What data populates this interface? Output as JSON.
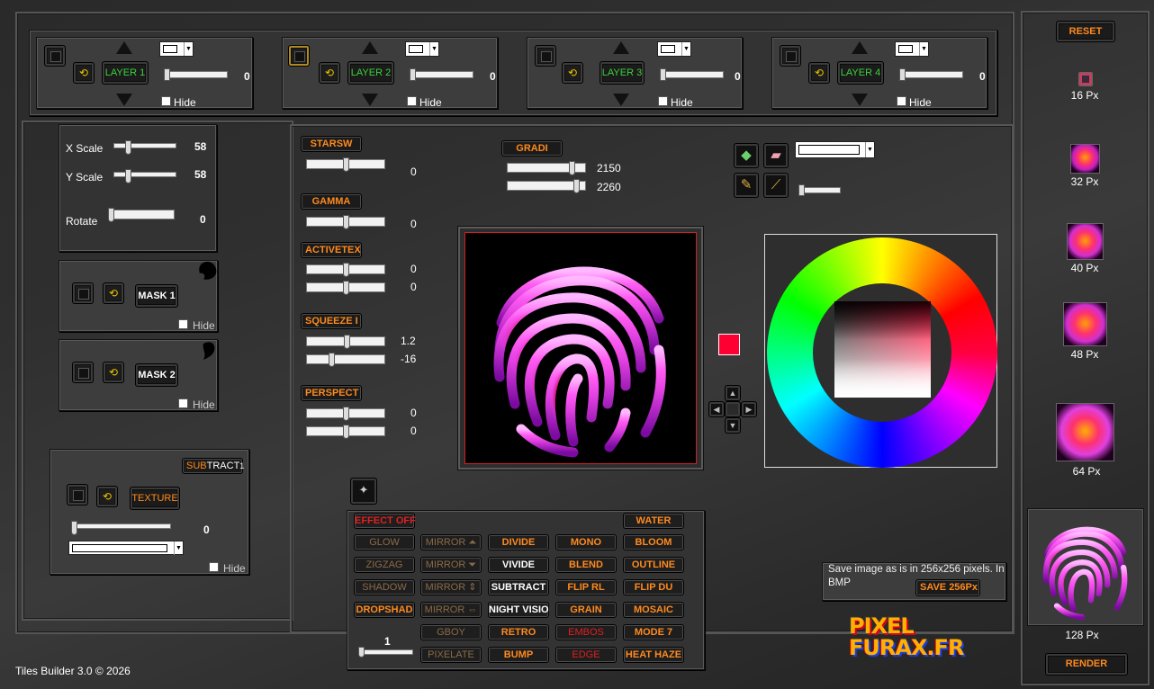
{
  "layers": [
    {
      "label": "LAYER 1",
      "opacity": "0",
      "hide": "Hide"
    },
    {
      "label": "LAYER 2",
      "opacity": "0",
      "hide": "Hide"
    },
    {
      "label": "LAYER 3",
      "opacity": "0",
      "hide": "Hide"
    },
    {
      "label": "LAYER 4",
      "opacity": "0",
      "hide": "Hide"
    }
  ],
  "transform": {
    "xscale_label": "X Scale",
    "xscale_value": "58",
    "yscale_label": "Y Scale",
    "yscale_value": "58",
    "rotate_label": "Rotate",
    "rotate_value": "0"
  },
  "masks": [
    {
      "label": "MASK 1",
      "hide": "Hide"
    },
    {
      "label": "MASK 2",
      "hide": "Hide"
    }
  ],
  "texture": {
    "blend_prefix": "SUB",
    "blend_suffix": "TRACT",
    "blend_number": "1",
    "label": "TEXTURE",
    "value": "0",
    "hide": "Hide"
  },
  "filters": [
    {
      "label": "STARSW",
      "values": [
        "0"
      ]
    },
    {
      "label": "GAMMA",
      "values": [
        "0"
      ]
    },
    {
      "label": "ACTIVETEX",
      "values": [
        "0",
        "0"
      ]
    },
    {
      "label": "SQUEEZE I",
      "values": [
        "1.2",
        "-16"
      ]
    },
    {
      "label": "PERSPECT",
      "values": [
        "0",
        "0"
      ]
    }
  ],
  "gradient": {
    "label": "GRADI",
    "values": [
      "2150",
      "2260"
    ]
  },
  "effects": {
    "off_label": "EFFECT OFF",
    "water_label": "WATER",
    "level": "1",
    "grid": [
      [
        "GLOW",
        "MIRROR ⏶",
        "DIVIDE",
        "MONO",
        "BLOOM"
      ],
      [
        "ZIGZAG",
        "MIRROR ⏷",
        "VIVIDE",
        "BLEND",
        "OUTLINE"
      ],
      [
        "SHADOW",
        "MIRROR ⇕",
        "SUBTRACT",
        "FLIP RL",
        "FLIP DU"
      ],
      [
        "DROPSHAD",
        "MIRROR ⇔",
        "NIGHT VISIO",
        "GRAIN",
        "MOSAIC"
      ],
      [
        "",
        "GBOY",
        "RETRO",
        "EMBOS",
        "MODE 7"
      ],
      [
        "",
        "PIXELATE",
        "BUMP",
        "EDGE",
        "HEAT HAZE"
      ]
    ]
  },
  "save": {
    "text": "Save image as is in 256x256 pixels. In BMP",
    "button": "SAVE 256Px"
  },
  "logo": {
    "line1": "PIXEL",
    "line2": "FURAX.FR"
  },
  "footer": "Tiles Builder 3.0 © 2026",
  "previews": {
    "reset": "RESET",
    "render": "RENDER",
    "sizes": [
      "16 Px",
      "32 Px",
      "40 Px",
      "48 Px",
      "64 Px",
      "128 Px"
    ]
  },
  "colors": {
    "accent_orange": "#ff8a1e",
    "selected_red": "#ff0033",
    "layer_green": "#3cd23c"
  }
}
